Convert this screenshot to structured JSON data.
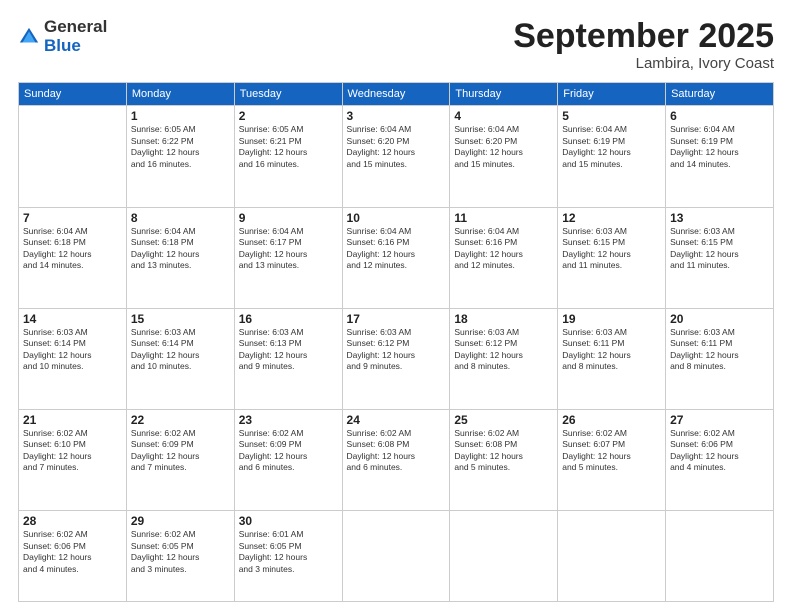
{
  "logo": {
    "general": "General",
    "blue": "Blue"
  },
  "header": {
    "month": "September 2025",
    "location": "Lambira, Ivory Coast"
  },
  "weekdays": [
    "Sunday",
    "Monday",
    "Tuesday",
    "Wednesday",
    "Thursday",
    "Friday",
    "Saturday"
  ],
  "weeks": [
    [
      {
        "day": "",
        "sunrise": "",
        "sunset": "",
        "daylight": ""
      },
      {
        "day": "1",
        "sunrise": "Sunrise: 6:05 AM",
        "sunset": "Sunset: 6:22 PM",
        "daylight": "Daylight: 12 hours and 16 minutes."
      },
      {
        "day": "2",
        "sunrise": "Sunrise: 6:05 AM",
        "sunset": "Sunset: 6:21 PM",
        "daylight": "Daylight: 12 hours and 16 minutes."
      },
      {
        "day": "3",
        "sunrise": "Sunrise: 6:04 AM",
        "sunset": "Sunset: 6:20 PM",
        "daylight": "Daylight: 12 hours and 15 minutes."
      },
      {
        "day": "4",
        "sunrise": "Sunrise: 6:04 AM",
        "sunset": "Sunset: 6:20 PM",
        "daylight": "Daylight: 12 hours and 15 minutes."
      },
      {
        "day": "5",
        "sunrise": "Sunrise: 6:04 AM",
        "sunset": "Sunset: 6:19 PM",
        "daylight": "Daylight: 12 hours and 15 minutes."
      },
      {
        "day": "6",
        "sunrise": "Sunrise: 6:04 AM",
        "sunset": "Sunset: 6:19 PM",
        "daylight": "Daylight: 12 hours and 14 minutes."
      }
    ],
    [
      {
        "day": "7",
        "sunrise": "Sunrise: 6:04 AM",
        "sunset": "Sunset: 6:18 PM",
        "daylight": "Daylight: 12 hours and 14 minutes."
      },
      {
        "day": "8",
        "sunrise": "Sunrise: 6:04 AM",
        "sunset": "Sunset: 6:18 PM",
        "daylight": "Daylight: 12 hours and 13 minutes."
      },
      {
        "day": "9",
        "sunrise": "Sunrise: 6:04 AM",
        "sunset": "Sunset: 6:17 PM",
        "daylight": "Daylight: 12 hours and 13 minutes."
      },
      {
        "day": "10",
        "sunrise": "Sunrise: 6:04 AM",
        "sunset": "Sunset: 6:16 PM",
        "daylight": "Daylight: 12 hours and 12 minutes."
      },
      {
        "day": "11",
        "sunrise": "Sunrise: 6:04 AM",
        "sunset": "Sunset: 6:16 PM",
        "daylight": "Daylight: 12 hours and 12 minutes."
      },
      {
        "day": "12",
        "sunrise": "Sunrise: 6:03 AM",
        "sunset": "Sunset: 6:15 PM",
        "daylight": "Daylight: 12 hours and 11 minutes."
      },
      {
        "day": "13",
        "sunrise": "Sunrise: 6:03 AM",
        "sunset": "Sunset: 6:15 PM",
        "daylight": "Daylight: 12 hours and 11 minutes."
      }
    ],
    [
      {
        "day": "14",
        "sunrise": "Sunrise: 6:03 AM",
        "sunset": "Sunset: 6:14 PM",
        "daylight": "Daylight: 12 hours and 10 minutes."
      },
      {
        "day": "15",
        "sunrise": "Sunrise: 6:03 AM",
        "sunset": "Sunset: 6:14 PM",
        "daylight": "Daylight: 12 hours and 10 minutes."
      },
      {
        "day": "16",
        "sunrise": "Sunrise: 6:03 AM",
        "sunset": "Sunset: 6:13 PM",
        "daylight": "Daylight: 12 hours and 9 minutes."
      },
      {
        "day": "17",
        "sunrise": "Sunrise: 6:03 AM",
        "sunset": "Sunset: 6:12 PM",
        "daylight": "Daylight: 12 hours and 9 minutes."
      },
      {
        "day": "18",
        "sunrise": "Sunrise: 6:03 AM",
        "sunset": "Sunset: 6:12 PM",
        "daylight": "Daylight: 12 hours and 8 minutes."
      },
      {
        "day": "19",
        "sunrise": "Sunrise: 6:03 AM",
        "sunset": "Sunset: 6:11 PM",
        "daylight": "Daylight: 12 hours and 8 minutes."
      },
      {
        "day": "20",
        "sunrise": "Sunrise: 6:03 AM",
        "sunset": "Sunset: 6:11 PM",
        "daylight": "Daylight: 12 hours and 8 minutes."
      }
    ],
    [
      {
        "day": "21",
        "sunrise": "Sunrise: 6:02 AM",
        "sunset": "Sunset: 6:10 PM",
        "daylight": "Daylight: 12 hours and 7 minutes."
      },
      {
        "day": "22",
        "sunrise": "Sunrise: 6:02 AM",
        "sunset": "Sunset: 6:09 PM",
        "daylight": "Daylight: 12 hours and 7 minutes."
      },
      {
        "day": "23",
        "sunrise": "Sunrise: 6:02 AM",
        "sunset": "Sunset: 6:09 PM",
        "daylight": "Daylight: 12 hours and 6 minutes."
      },
      {
        "day": "24",
        "sunrise": "Sunrise: 6:02 AM",
        "sunset": "Sunset: 6:08 PM",
        "daylight": "Daylight: 12 hours and 6 minutes."
      },
      {
        "day": "25",
        "sunrise": "Sunrise: 6:02 AM",
        "sunset": "Sunset: 6:08 PM",
        "daylight": "Daylight: 12 hours and 5 minutes."
      },
      {
        "day": "26",
        "sunrise": "Sunrise: 6:02 AM",
        "sunset": "Sunset: 6:07 PM",
        "daylight": "Daylight: 12 hours and 5 minutes."
      },
      {
        "day": "27",
        "sunrise": "Sunrise: 6:02 AM",
        "sunset": "Sunset: 6:06 PM",
        "daylight": "Daylight: 12 hours and 4 minutes."
      }
    ],
    [
      {
        "day": "28",
        "sunrise": "Sunrise: 6:02 AM",
        "sunset": "Sunset: 6:06 PM",
        "daylight": "Daylight: 12 hours and 4 minutes."
      },
      {
        "day": "29",
        "sunrise": "Sunrise: 6:02 AM",
        "sunset": "Sunset: 6:05 PM",
        "daylight": "Daylight: 12 hours and 3 minutes."
      },
      {
        "day": "30",
        "sunrise": "Sunrise: 6:01 AM",
        "sunset": "Sunset: 6:05 PM",
        "daylight": "Daylight: 12 hours and 3 minutes."
      },
      {
        "day": "",
        "sunrise": "",
        "sunset": "",
        "daylight": ""
      },
      {
        "day": "",
        "sunrise": "",
        "sunset": "",
        "daylight": ""
      },
      {
        "day": "",
        "sunrise": "",
        "sunset": "",
        "daylight": ""
      },
      {
        "day": "",
        "sunrise": "",
        "sunset": "",
        "daylight": ""
      }
    ]
  ]
}
